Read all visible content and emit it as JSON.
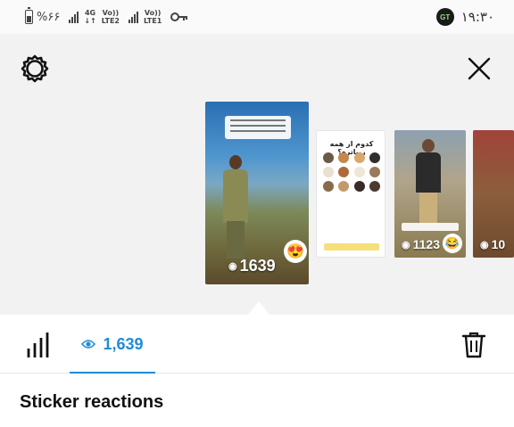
{
  "status_bar": {
    "battery_percent": "%۶۶",
    "sim1_network": "4G",
    "sim1_volte": "Vo))",
    "sim1_lte": "LTE2",
    "sim2_volte": "Vo))",
    "sim2_lte": "LTE1",
    "app_badge": "GT",
    "clock": "۱۹:۳۰"
  },
  "header": {
    "settings_icon": "gear-icon",
    "close_icon": "close-icon"
  },
  "stories": {
    "main": {
      "views": "1639",
      "emoji": "😍"
    },
    "second": {
      "title": "کدوم از همه زیباتره؟"
    },
    "third": {
      "views": "1123",
      "emoji": "😂"
    },
    "fourth": {
      "views": "10"
    }
  },
  "tabs": {
    "insights_icon": "bar-chart-icon",
    "viewers_count": "1,639",
    "delete_icon": "trash-icon",
    "accent_color": "#1f8cd6"
  },
  "section": {
    "title": "Sticker reactions"
  }
}
